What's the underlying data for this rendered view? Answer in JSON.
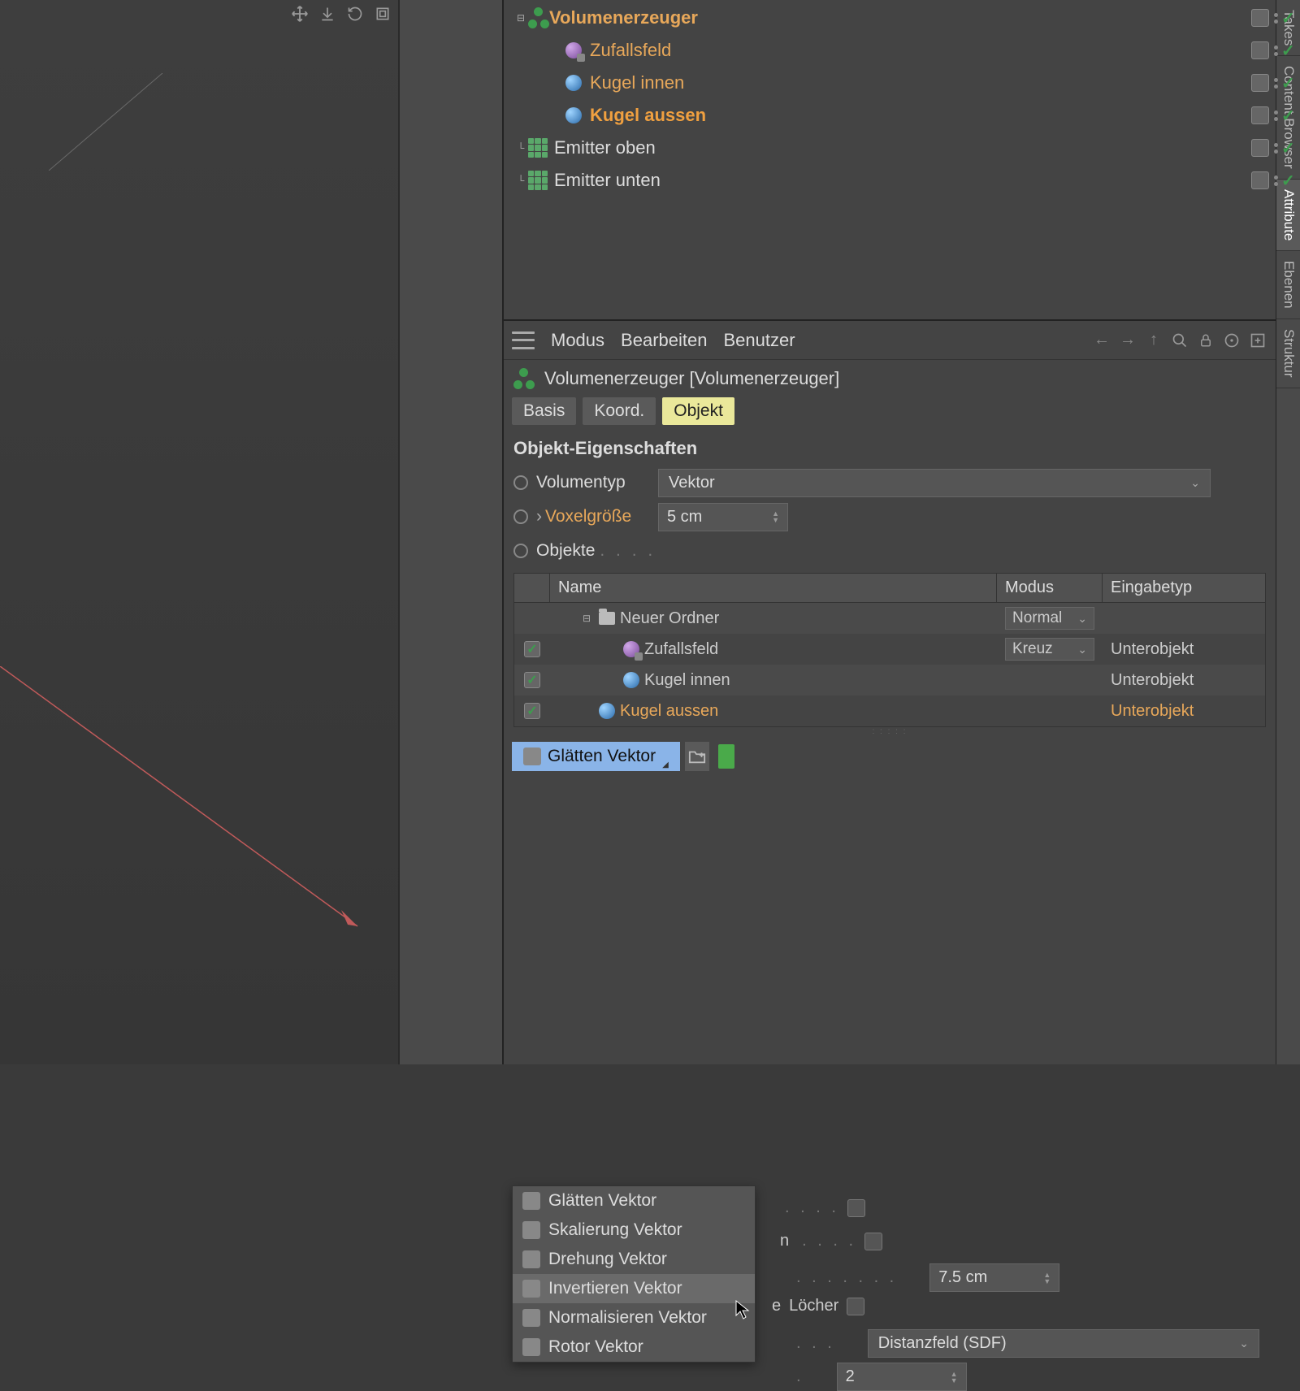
{
  "viewport": {},
  "right_tabs": [
    "Takes",
    "Content Browser",
    "Attribute",
    "Ebenen",
    "Struktur"
  ],
  "active_right_tab": "Attribute",
  "object_tree": {
    "items": [
      {
        "name": "Volumenerzeuger",
        "icon": "volume",
        "orange": true,
        "bold": true,
        "indent": 0,
        "expanded": true
      },
      {
        "name": "Zufallsfeld",
        "icon": "random",
        "orange": true,
        "indent": 1
      },
      {
        "name": "Kugel innen",
        "icon": "sphere",
        "orange": true,
        "indent": 1,
        "tag": "balls"
      },
      {
        "name": "Kugel aussen",
        "icon": "sphere",
        "orange": true,
        "bold": true,
        "selected": true,
        "indent": 1,
        "tag": "balls"
      },
      {
        "name": "Emitter oben",
        "icon": "emitter",
        "indent": 0
      },
      {
        "name": "Emitter unten",
        "icon": "emitter",
        "indent": 0
      }
    ]
  },
  "attr": {
    "menus": {
      "mode": "Modus",
      "edit": "Bearbeiten",
      "user": "Benutzer"
    },
    "object_title": "Volumenerzeuger [Volumenerzeuger]",
    "tabs": {
      "basis": "Basis",
      "coord": "Koord.",
      "object": "Objekt"
    },
    "active_tab": "Objekt",
    "section": "Objekt-Eigenschaften",
    "volumentyp_label": "Volumentyp",
    "volumentyp_value": "Vektor",
    "voxel_label": "Voxelgröße",
    "voxel_value": "5 cm",
    "objects_label": "Objekte",
    "table": {
      "headers": {
        "name": "Name",
        "mode": "Modus",
        "type": "Eingabetyp"
      },
      "rows": [
        {
          "checked": null,
          "name": "Neuer Ordner",
          "icon": "folder",
          "mode": "Normal",
          "type": "",
          "indent": 0,
          "expanded": true
        },
        {
          "checked": true,
          "name": "Zufallsfeld",
          "icon": "random",
          "mode": "Kreuz",
          "type": "Unterobjekt",
          "indent": 1
        },
        {
          "checked": true,
          "name": "Kugel innen",
          "icon": "sphere",
          "mode": "",
          "type": "Unterobjekt",
          "indent": 1
        },
        {
          "checked": true,
          "name": "Kugel aussen",
          "icon": "sphere",
          "mode": "",
          "type": "Unterobjekt",
          "indent": 0,
          "orange": true
        }
      ]
    },
    "filter_button": "Glätten Vektor",
    "filter_menu": [
      "Glätten Vektor",
      "Skalierung Vektor",
      "Drehung Vektor",
      "Invertieren Vektor",
      "Normalisieren Vektor",
      "Rotor Vektor"
    ],
    "filter_hover_index": 3,
    "bg_props": {
      "p1_label_tail": "n",
      "p2_value": "7.5 cm",
      "p3_label": "Löcher",
      "p4_value": "Distanzfeld (SDF)",
      "p5_value": "2"
    }
  }
}
